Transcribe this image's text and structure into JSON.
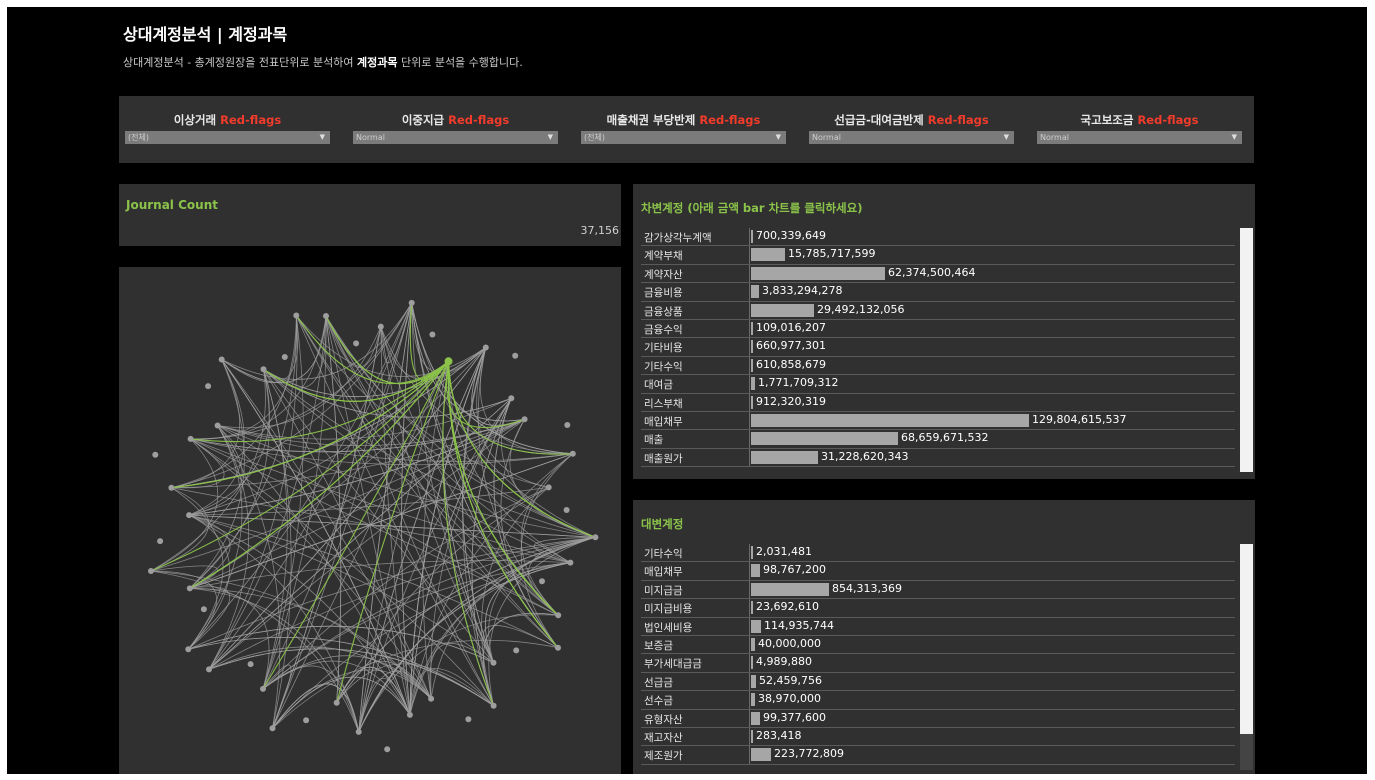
{
  "header": {
    "title": "상대계정분석 | 계정과목",
    "subtitle_prefix": "상대계정분석 - 총계정원장을 전표단위로 분석하여 ",
    "subtitle_bold": "계정과목",
    "subtitle_suffix": " 단위로 분석을 수행합니다."
  },
  "filters": [
    {
      "label": "이상거래 ",
      "flag": "Red-flags",
      "value": "(전체)"
    },
    {
      "label": "이중지급 ",
      "flag": "Red-flags",
      "value": "Normal"
    },
    {
      "label": "매출채권 부당반제 ",
      "flag": "Red-flags",
      "value": "(전체)"
    },
    {
      "label": "선급금-대여금반제 ",
      "flag": "Red-flags",
      "value": "Normal"
    },
    {
      "label": "국고보조금 ",
      "flag": "Red-flags",
      "value": "Normal"
    }
  ],
  "journal": {
    "title": "Journal Count",
    "value": "37,156"
  },
  "debit": {
    "title": "차변계정 (아래 금액 bar 차트를 클릭하세요)",
    "rows": [
      {
        "account": "감가상각누계액",
        "amount": "700,339,649",
        "value": 700339649
      },
      {
        "account": "계약부채",
        "amount": "15,785,717,599",
        "value": 15785717599
      },
      {
        "account": "계약자산",
        "amount": "62,374,500,464",
        "value": 62374500464
      },
      {
        "account": "금융비용",
        "amount": "3,833,294,278",
        "value": 3833294278
      },
      {
        "account": "금융상품",
        "amount": "29,492,132,056",
        "value": 29492132056
      },
      {
        "account": "금융수익",
        "amount": "109,016,207",
        "value": 109016207
      },
      {
        "account": "기타비용",
        "amount": "660,977,301",
        "value": 660977301
      },
      {
        "account": "기타수익",
        "amount": "610,858,679",
        "value": 610858679
      },
      {
        "account": "대여금",
        "amount": "1,771,709,312",
        "value": 1771709312
      },
      {
        "account": "리스부채",
        "amount": "912,320,319",
        "value": 912320319
      },
      {
        "account": "매입채무",
        "amount": "129,804,615,537",
        "value": 129804615537
      },
      {
        "account": "매출",
        "amount": "68,659,671,532",
        "value": 68659671532
      },
      {
        "account": "매출원가",
        "amount": "31,228,620,343",
        "value": 31228620343
      }
    ]
  },
  "credit": {
    "title": "대변계정",
    "rows": [
      {
        "account": "기타수익",
        "amount": "2,031,481",
        "value": 2031481
      },
      {
        "account": "매입채무",
        "amount": "98,767,200",
        "value": 98767200
      },
      {
        "account": "미지급금",
        "amount": "854,313,369",
        "value": 854313369
      },
      {
        "account": "미지급비용",
        "amount": "23,692,610",
        "value": 23692610
      },
      {
        "account": "법인세비용",
        "amount": "114,935,744",
        "value": 114935744
      },
      {
        "account": "보증금",
        "amount": "40,000,000",
        "value": 40000000
      },
      {
        "account": "부가세대급금",
        "amount": "4,989,880",
        "value": 4989880
      },
      {
        "account": "선급금",
        "amount": "52,459,756",
        "value": 52459756
      },
      {
        "account": "선수금",
        "amount": "38,970,000",
        "value": 38970000
      },
      {
        "account": "유형자산",
        "amount": "99,377,600",
        "value": 99377600
      },
      {
        "account": "재고자산",
        "amount": "283,418",
        "value": 283418
      },
      {
        "account": "제조원가",
        "amount": "223,772,809",
        "value": 223772809
      }
    ]
  },
  "colors": {
    "highlight": "#8bc34a",
    "flag": "#f23b2b",
    "node": "#9e9e9e",
    "edge": "#a0a0a0",
    "bar": "#a6a6a6"
  },
  "network": {
    "node_count": 48,
    "highlighted_node_index": 2
  }
}
